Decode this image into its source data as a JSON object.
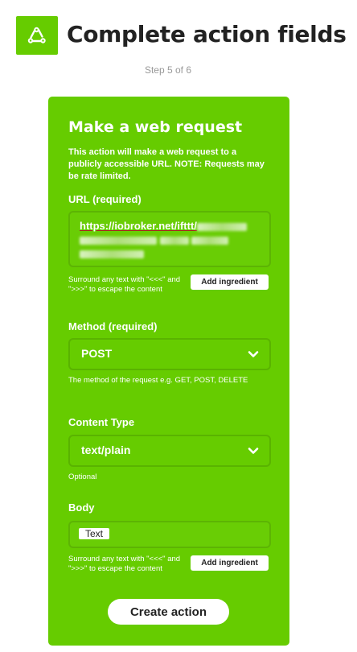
{
  "header": {
    "title": "Complete action fields",
    "step": "Step 5 of 6",
    "logo_icon": "webhooks-icon",
    "accent_color": "#66cc00"
  },
  "card": {
    "title": "Make a web request",
    "description": "This action will make a web request to a publicly accessible URL. NOTE: Requests may be rate limited.",
    "url": {
      "label": "URL (required)",
      "value": "https://iobroker.net/ifttt/",
      "hint": "Surround any text with \"<<<\" and \">>>\" to escape the content",
      "ingredient_button": "Add ingredient"
    },
    "method": {
      "label": "Method (required)",
      "value": "POST",
      "hint": "The method of the request e.g. GET, POST, DELETE"
    },
    "content_type": {
      "label": "Content Type",
      "value": "text/plain",
      "hint": "Optional"
    },
    "body": {
      "label": "Body",
      "value": "Text",
      "hint": "Surround any text with \"<<<\" and \">>>\" to escape the content",
      "ingredient_button": "Add ingredient"
    },
    "submit_button": "Create action"
  }
}
